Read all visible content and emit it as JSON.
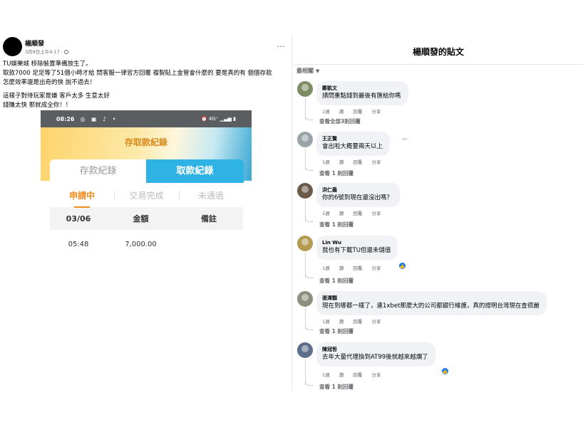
{
  "post": {
    "author": "楊順發",
    "time": "3月9日上午4:17 ·",
    "lines": [
      "TU娛樂城 移除裝置準備放生了。",
      "取款7000 足足等了51個小時才給 問客服一律官方回覆 複製貼上金管會什麼的 要是真的有 個個存款",
      "怎麼效率還是出奇的快 說不過去！",
      "這樣子對待玩家是嫌 客戶太多 生意太好",
      "錢賺太快 那就成全你！！"
    ],
    "more_icon": "…"
  },
  "phone": {
    "status_time": "08:26",
    "status_icons": "◎ ▣ ♪ •",
    "status_right": "⏰ 4G⁺ ▁▃▅ ▮",
    "page_title": "存取款紀錄",
    "tabs": {
      "deposit": "存款紀錄",
      "withdraw": "取款紀錄"
    },
    "status_tabs": [
      "申請中",
      "交易完成",
      "未通過"
    ],
    "table_header": {
      "date": "03/06",
      "amount": "金額",
      "note": "備註"
    },
    "row": {
      "time": "05:48",
      "amount": "7,000.00",
      "note": ""
    }
  },
  "panel": {
    "title": "楊順發的貼文",
    "sort": "最相關",
    "comments": [
      {
        "name": "鄭凱文",
        "text": "請問重點錢到最後有匯給你嗎",
        "actions": [
          "1週",
          "讚",
          "回覆",
          "分享"
        ],
        "more": "查看全部3則回覆"
      },
      {
        "name": "王正賢",
        "text": "會出啦大概要兩天以上",
        "actions": [
          "1週",
          "讚",
          "回覆",
          "分享"
        ],
        "more": "查看 1 則回覆"
      },
      {
        "name": "洪仁義",
        "text": "你的6號到現在還沒出嗎？",
        "actions": [
          "1週",
          "讚",
          "回覆",
          "分享"
        ],
        "more": "查看 1 則回覆"
      },
      {
        "name": "Lin Wu",
        "text": "我也有下載TU但還未儲值",
        "actions": [
          "1週",
          "讚",
          "回覆",
          "分享"
        ],
        "more": "查看 1 則回覆"
      },
      {
        "name": "張澤顥",
        "text": "現在到哪都一樣了，連1xbet那麼大的公司都銀行維護，真的證明台灣現在查很嚴",
        "actions": [
          "1週",
          "讚",
          "回覆",
          "分享"
        ],
        "more": "查看 1 則回覆"
      },
      {
        "name": "陳冠哲",
        "text": "去年大量代理換到AT99後就越來越爛了",
        "actions": [
          "1週",
          "讚",
          "回覆",
          "分享"
        ],
        "more": "查看 1 則回覆"
      }
    ]
  },
  "colors": {
    "accent_blue": "#2fb3e5",
    "accent_orange": "#f08a1a",
    "like_blue": "#1877f2"
  }
}
